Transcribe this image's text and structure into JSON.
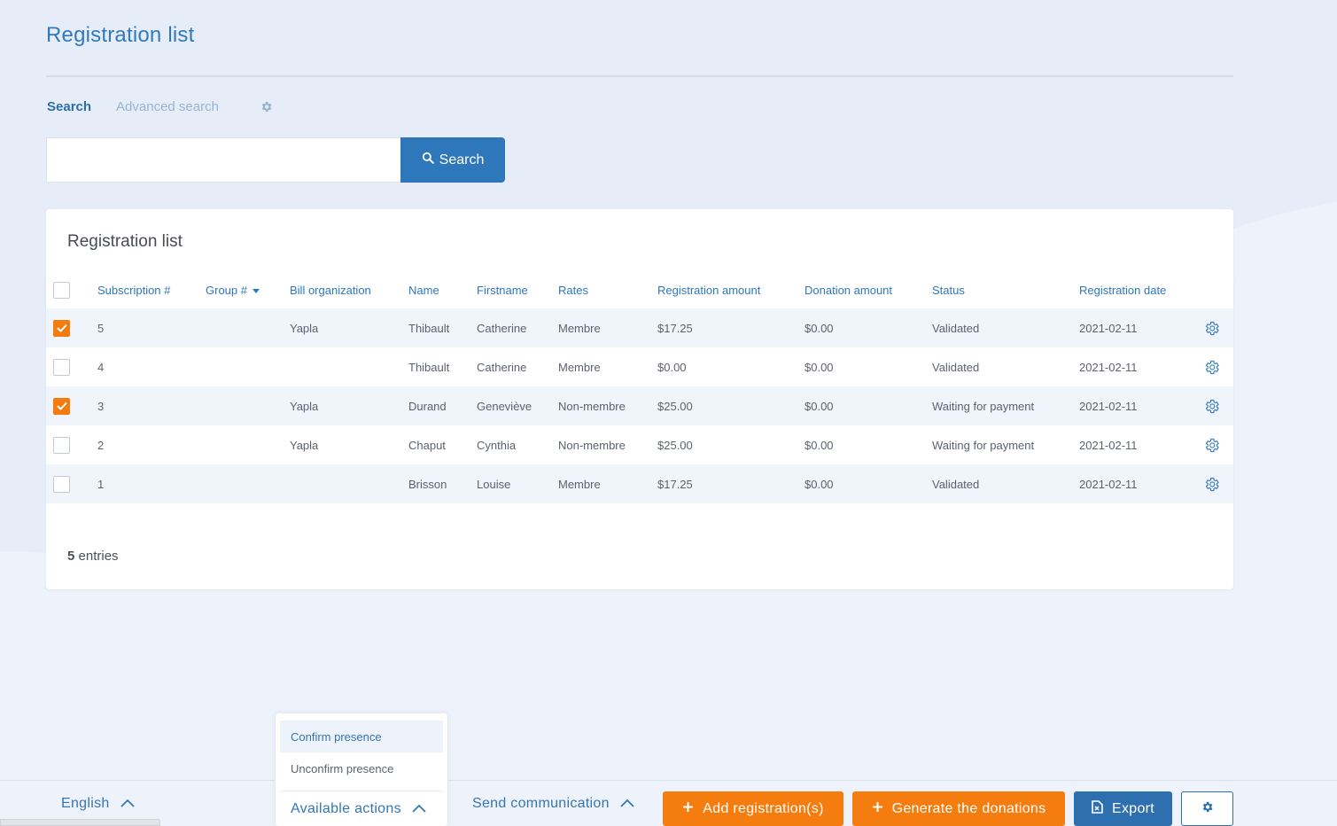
{
  "page": {
    "title": "Registration list"
  },
  "search": {
    "tab_search": "Search",
    "tab_advanced": "Advanced search",
    "input_value": "",
    "button_label": "Search"
  },
  "card": {
    "title": "Registration list",
    "columns": [
      "Subscription #",
      "Group #",
      "Bill organization",
      "Name",
      "Firstname",
      "Rates",
      "Registration amount",
      "Donation amount",
      "Status",
      "Registration date"
    ],
    "rows": [
      {
        "checked": true,
        "subscription": "5",
        "group": "",
        "bill_org": "Yapla",
        "name": "Thibault",
        "firstname": "Catherine",
        "rate": "Membre",
        "reg_amount": "$17.25",
        "donation": "$0.00",
        "status": "Validated",
        "date": "2021-02-11"
      },
      {
        "checked": false,
        "subscription": "4",
        "group": "",
        "bill_org": "",
        "name": "Thibault",
        "firstname": "Catherine",
        "rate": "Membre",
        "reg_amount": "$0.00",
        "donation": "$0.00",
        "status": "Validated",
        "date": "2021-02-11"
      },
      {
        "checked": true,
        "subscription": "3",
        "group": "",
        "bill_org": "Yapla",
        "name": "Durand",
        "firstname": "Geneviève",
        "rate": "Non-membre",
        "reg_amount": "$25.00",
        "donation": "$0.00",
        "status": "Waiting for payment",
        "date": "2021-02-11"
      },
      {
        "checked": false,
        "subscription": "2",
        "group": "",
        "bill_org": "Yapla",
        "name": "Chaput",
        "firstname": "Cynthia",
        "rate": "Non-membre",
        "reg_amount": "$25.00",
        "donation": "$0.00",
        "status": "Waiting for payment",
        "date": "2021-02-11"
      },
      {
        "checked": false,
        "subscription": "1",
        "group": "",
        "bill_org": "",
        "name": "Brisson",
        "firstname": "Louise",
        "rate": "Membre",
        "reg_amount": "$17.25",
        "donation": "$0.00",
        "status": "Validated",
        "date": "2021-02-11"
      }
    ],
    "entries_count": "5",
    "entries_label": "entries"
  },
  "bottom_bar": {
    "language": "English",
    "available_actions": "Available actions",
    "send_communication": "Send communication",
    "add_registration": "Add registration(s)",
    "generate_donations": "Generate the donations",
    "export": "Export"
  },
  "actions_menu": {
    "items": [
      "Confirm presence",
      "Unconfirm presence"
    ]
  },
  "colors": {
    "accent_blue": "#2e77bb",
    "accent_orange": "#f57c0e",
    "checkbox_checked": "#f47c0f",
    "background": "#eef2fa"
  },
  "icons": {
    "search_button": "search-icon",
    "tab_settings": "gear-icon",
    "row_action": "gear-icon",
    "add": "plus-icon",
    "export": "file-export-icon",
    "toggle": "chevron-up-icon"
  }
}
